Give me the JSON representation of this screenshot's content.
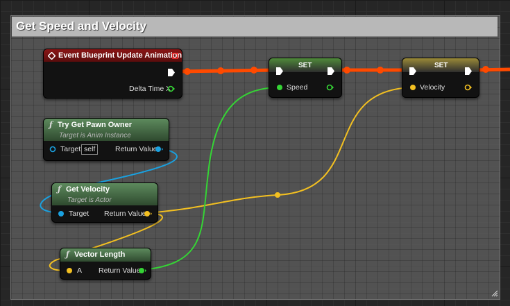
{
  "comment": {
    "title": "Get Speed and Velocity"
  },
  "nodes": {
    "event_update": {
      "title": "Event Blueprint Update Animation",
      "delta_label": "Delta Time X"
    },
    "try_get_pawn_owner": {
      "title": "Try Get Pawn Owner",
      "subtitle": "Target is Anim Instance",
      "target_label": "Target",
      "target_value": "self",
      "return_label": "Return Value"
    },
    "get_velocity": {
      "title": "Get Velocity",
      "subtitle": "Target is Actor",
      "target_label": "Target",
      "return_label": "Return Value"
    },
    "vector_length": {
      "title": "Vector Length",
      "a_label": "A",
      "return_label": "Return Value"
    },
    "set_speed": {
      "title": "SET",
      "pin_label": "Speed"
    },
    "set_velocity": {
      "title": "SET",
      "pin_label": "Velocity"
    }
  },
  "colors": {
    "exec_wire": "#ff4a00",
    "float_pin": "#35d435",
    "vector_pin": "#f3c021",
    "object_pin": "#1aa1e0",
    "event_header": "#8a1616",
    "function_header": "#4f7a4f"
  },
  "icons": {
    "event": "event-diamond-icon",
    "function": "function-f-icon",
    "event_delegate": "delegate-square-icon"
  }
}
